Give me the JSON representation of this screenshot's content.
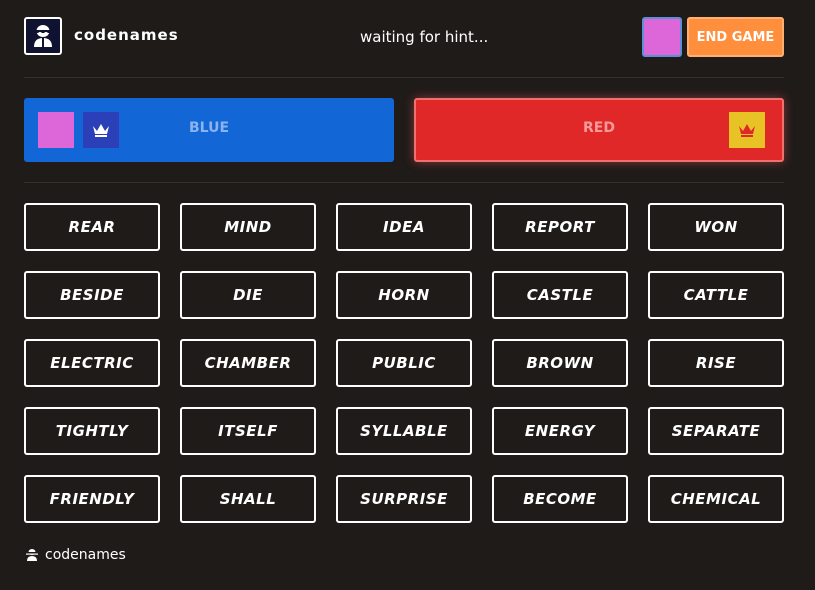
{
  "header": {
    "brand": "codenames",
    "status": "waiting for hint...",
    "end_game_label": "END GAME",
    "player_color": "#dd66d8"
  },
  "teams": {
    "blue": {
      "label": "BLUE",
      "color": "#1366d6",
      "icon": "crown-icon"
    },
    "red": {
      "label": "RED",
      "color": "#e12828",
      "icon": "crown-icon"
    }
  },
  "board": {
    "rows": [
      [
        "REAR",
        "MIND",
        "IDEA",
        "REPORT",
        "WON"
      ],
      [
        "BESIDE",
        "DIE",
        "HORN",
        "CASTLE",
        "CATTLE"
      ],
      [
        "ELECTRIC",
        "CHAMBER",
        "PUBLIC",
        "BROWN",
        "RISE"
      ],
      [
        "TIGHTLY",
        "ITSELF",
        "SYLLABLE",
        "ENERGY",
        "SEPARATE"
      ],
      [
        "FRIENDLY",
        "SHALL",
        "SURPRISE",
        "BECOME",
        "CHEMICAL"
      ]
    ]
  },
  "footer": {
    "brand": "codenames",
    "icon": "spy-icon"
  }
}
